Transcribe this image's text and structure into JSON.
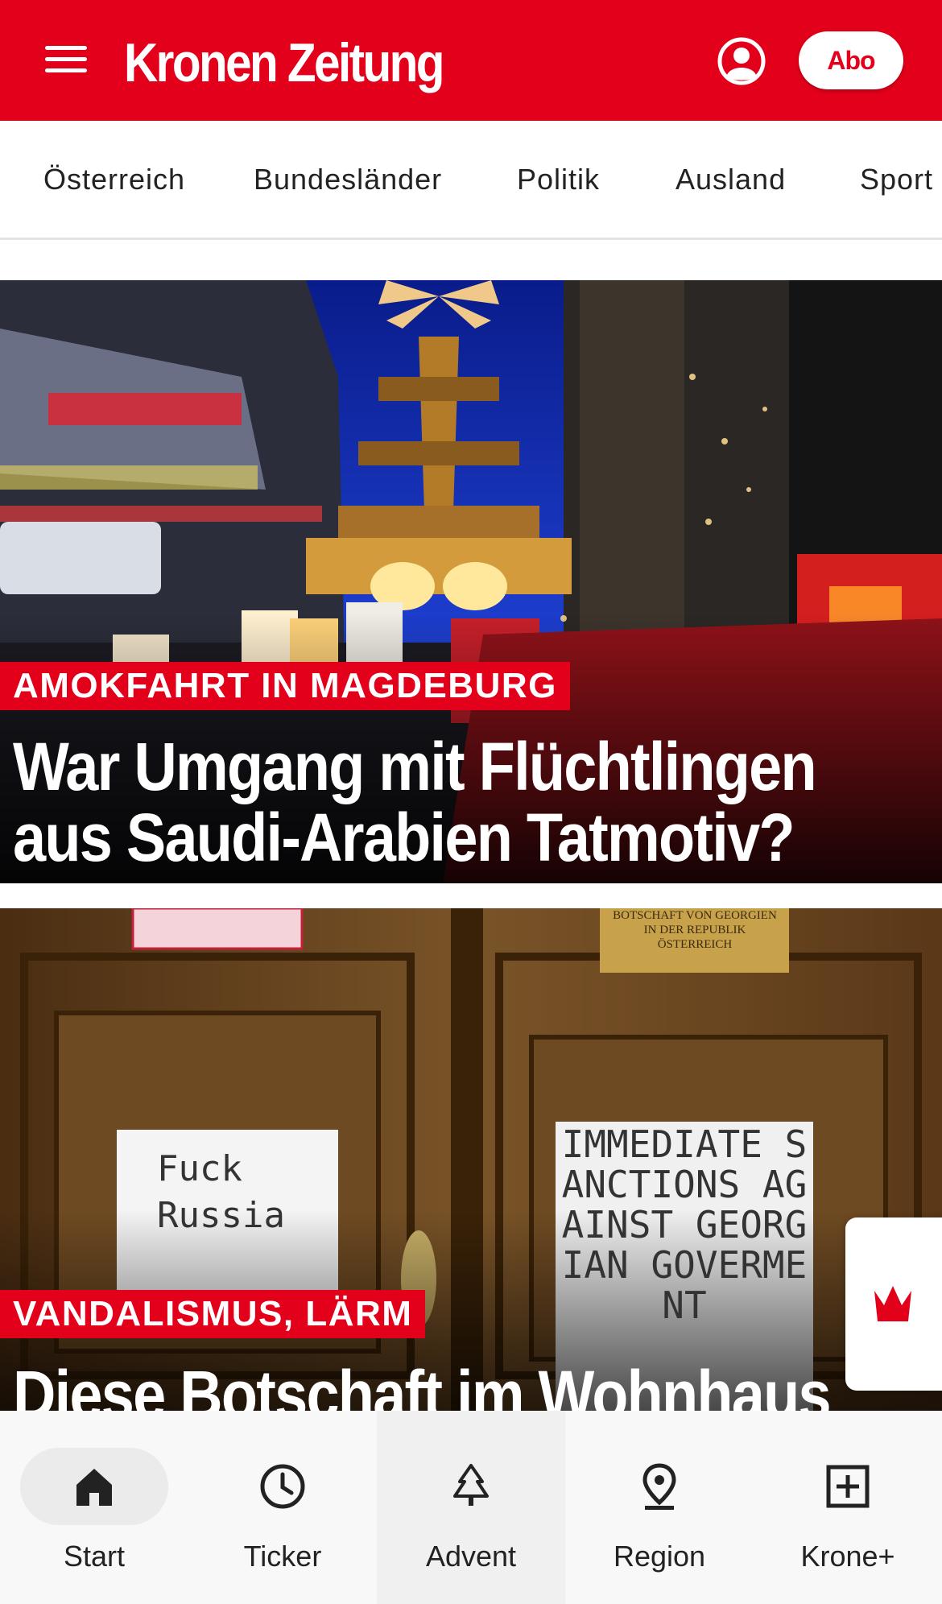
{
  "header": {
    "logo_text": "Kronen Zeitung",
    "abo_label": "Abo",
    "brand_color": "#e2001a",
    "icons": [
      "menu-icon",
      "user-icon"
    ]
  },
  "categories": [
    "Österreich",
    "Bundesländer",
    "Politik",
    "Ausland",
    "Sport"
  ],
  "articles": [
    {
      "kicker": "AMOKFAHRT IN MAGDEBURG",
      "headline": "War Umgang mit Flüchtlingen aus Saudi-Arabien Tatmotiv?"
    },
    {
      "kicker": "VANDALISMUS, LÄRM",
      "headline": "Diese Botschaft im Wohnhaus",
      "image_text": {
        "plaque": "BOTSCHAFT VON GEORGIEN IN DER REPUBLIK ÖSTERREICH",
        "sign_left": "Fuck Russia",
        "sign_right": "IMMEDIATE SANCTIONS AGAINST GEORGIAN GOVERMENT"
      }
    }
  ],
  "floating_button": {
    "icon": "crown-icon"
  },
  "bottom_nav": [
    {
      "label": "Start",
      "icon": "home-icon",
      "active": true
    },
    {
      "label": "Ticker",
      "icon": "clock-icon"
    },
    {
      "label": "Advent",
      "icon": "tree-icon"
    },
    {
      "label": "Region",
      "icon": "location-pin-icon"
    },
    {
      "label": "Krone+",
      "icon": "plus-square-icon"
    }
  ]
}
